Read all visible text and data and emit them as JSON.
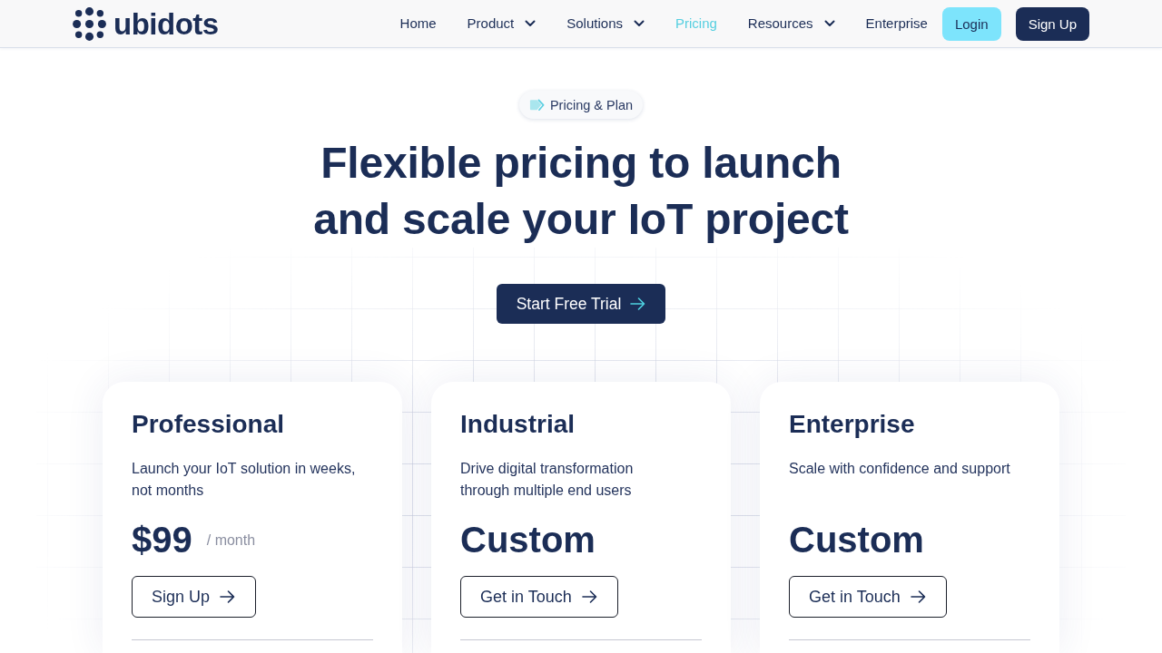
{
  "nav": {
    "logo": {
      "text": "ubidots"
    },
    "items": [
      {
        "label": "Home",
        "selected": false,
        "has_dropdown": false
      },
      {
        "label": "Product",
        "selected": false,
        "has_dropdown": true
      },
      {
        "label": "Solutions",
        "selected": false,
        "has_dropdown": true
      },
      {
        "label": "Pricing",
        "selected": true,
        "has_dropdown": false
      },
      {
        "label": "Resources",
        "selected": false,
        "has_dropdown": true
      },
      {
        "label": "Enterprise",
        "selected": false,
        "has_dropdown": false
      }
    ],
    "actions": [
      {
        "label": "Login",
        "kind": "secondary"
      },
      {
        "label": "Sign Up",
        "kind": "primary"
      }
    ]
  },
  "hero": {
    "badge": "Pricing & Plan",
    "title": "Flexible pricing to launch and scale your IoT project",
    "cta": "Start Free Trial"
  },
  "plans": [
    {
      "name": "Professional",
      "description": "Launch your IoT solution in weeks, not months",
      "price": "$99",
      "period": "/ month",
      "button": "Sign Up"
    },
    {
      "name": "Industrial",
      "description": "Drive digital transformation through multiple end users",
      "price": "Custom",
      "button": "Get in Touch"
    },
    {
      "name": "Enterprise",
      "description": "Scale with confidence and support",
      "price": "Custom",
      "button": "Get in Touch"
    }
  ]
}
